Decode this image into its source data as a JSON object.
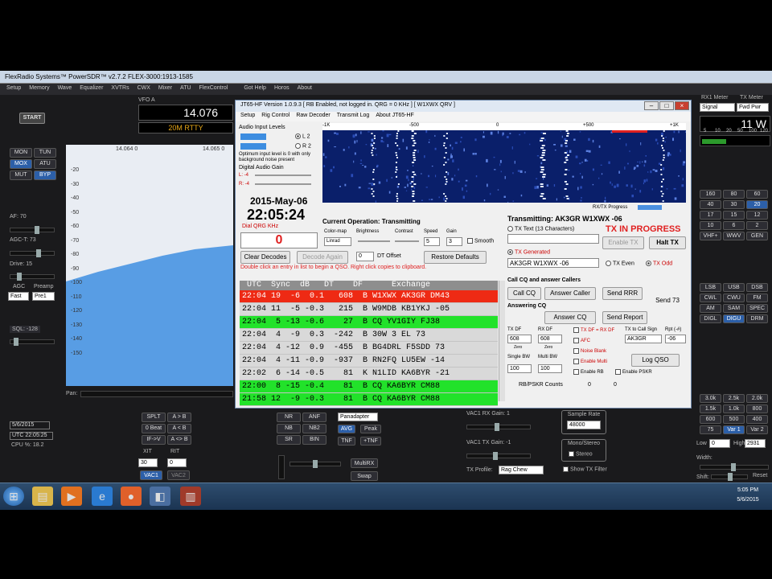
{
  "psdr": {
    "title": "FlexRadio Systems™  PowerSDR™  v2.7.2   FLEX-3000:1913-1585",
    "menu": [
      "Setup",
      "Memory",
      "Wave",
      "Equalizer",
      "XVTRs",
      "CWX",
      "Mixer",
      "ATU",
      "FlexControl",
      "",
      "Got Help",
      "Horos",
      "About"
    ],
    "start": "START",
    "vfo_label": "VFO A",
    "vfo_freq": "14.076",
    "vfo_mode": "20M RTTY",
    "pan_top": [
      "14.064 0",
      "14.065 0"
    ],
    "db_scale": [
      "-20",
      "-30",
      "-40",
      "-50",
      "-60",
      "-70",
      "-80",
      "-90",
      "-100",
      "-110",
      "-120",
      "-130",
      "-140",
      "-150"
    ],
    "mode_buttons": [
      "MON",
      "TUN",
      "MOX",
      "ATU",
      "MUT",
      "BYP"
    ],
    "af": "AF:  70",
    "agc_t": "AGC-T:  73",
    "drive": "Drive:  15",
    "agc": "AGC",
    "agc_val": "Fast",
    "preamp": "Preamp",
    "preamp_val": "Pre1",
    "sql": "SQL: -128",
    "pan_label": "Pan:",
    "date": "5/6/2015",
    "utc": "UTC 22:05:25",
    "cpu": "CPU %: 18.2",
    "split_buttons": [
      "SPLT",
      "A > B",
      "0 Beat",
      "A < B",
      "IF->V",
      "A <> B"
    ],
    "xit": "XIT",
    "rit": "RIT",
    "xit_val": "30",
    "rit_val": "0",
    "vac1": "VAC1",
    "vac2": "VAC2",
    "nr_buttons": [
      "NR",
      "ANF",
      "NB",
      "NB2",
      "SR",
      "BIN"
    ],
    "display_mode": "Panadapter",
    "avg": "AVG",
    "peak": "Peak",
    "tnf": "TNF",
    "ptnf": "+TNF",
    "multirx": "MultiRX",
    "swap": "Swap",
    "vac1_rx": "VAC1 RX Gain:  1",
    "vac1_tx": "VAC1 TX Gain:  -1",
    "tx_profile_label": "TX Profile:",
    "tx_profile_val": "Rag Chew",
    "sample_rate": "Sample Rate",
    "sample_rate_val": "48000",
    "mono_stereo": "Mono/Stereo",
    "stereo": "Stereo",
    "show_tx_filter": "Show TX Filter",
    "rx1_meter": "RX1 Meter",
    "tx_meter": "TX Meter",
    "meter_sel_rx": "Signal",
    "meter_sel_tx": "Fwd Pwr",
    "meter_val": "11 W",
    "meter_scale": [
      "5",
      "10",
      "20",
      "50",
      "100",
      "120"
    ],
    "bands": [
      "160",
      "80",
      "60",
      "40",
      "30",
      "20",
      "17",
      "15",
      "12",
      "10",
      "6",
      "2",
      "VHF+",
      "WWV",
      "GEN"
    ],
    "modes": [
      "LSB",
      "USB",
      "DSB",
      "CWL",
      "CWU",
      "FM",
      "AM",
      "SAM",
      "SPEC",
      "DIGL",
      "DIGU",
      "DRM"
    ],
    "filters": [
      "3.0k",
      "2.5k",
      "2.0k",
      "1.5k",
      "1.0k",
      "800",
      "600",
      "500",
      "400",
      "75",
      "Var 1",
      "Var 2"
    ],
    "low_label": "Low",
    "low_val": "0",
    "high_label": "High",
    "high_val": "2931",
    "width": "Width:",
    "shift": "Shift:",
    "reset": "Reset"
  },
  "jt": {
    "title": "JT65-HF Version 1.0.9.3  [ RB Enabled, not logged in.  QRG = 0 KHz ]  [ W1XWX QRV ]",
    "menu": [
      "Setup",
      "Rig Control",
      "Raw Decoder",
      "Transmit Log",
      "About JT65-HF"
    ],
    "audio_levels": "Audio Input Levels",
    "l2": "L 2",
    "r2": "R 2",
    "opt_note": "Optimum input level is 0 with only background noise present",
    "digital_gain": "Digital Audio Gain",
    "l_gain": "L: -4",
    "r_gain": "R: -4",
    "date": "2015-May-06",
    "time": "22:05:24",
    "dial_label": "Dial QRG KHz",
    "dial_val": "0",
    "scale": [
      "-1K",
      "-500",
      "0",
      "+500",
      "+1K"
    ],
    "rxtx_progress": "RX/TX Progress",
    "current_op_label": "Current Operation:",
    "current_op": "Transmitting",
    "color_map": "Color-map",
    "brightness": "Brightness",
    "contrast": "Contrast",
    "speed": "Speed",
    "gain": "Gain",
    "color_map_val": "Linrad",
    "speed_val": "5",
    "gain_val": "3",
    "smooth": "Smooth",
    "clear_decodes": "Clear Decodes",
    "decode_again": "Decode Again",
    "dt_offset_val": "0",
    "dt_offset": "DT Offset",
    "restore_defaults": "Restore Defaults",
    "hint": "Double click an entry in list to begin a QSO.  Right click copies to clipboard.",
    "table_header": " UTC  Sync  dB   DT    DF      Exchange",
    "rows": [
      {
        "text": "22:04 19  -6  0.1   608  B W1XWX AK3GR DM43",
        "style": "red"
      },
      {
        "text": "22:04 11  -5 -0.3   215  B W9MDB KB1YKJ -05",
        "style": ""
      },
      {
        "text": "22:04  5 -13 -0.6    27  B CQ YV1GIY FJ38",
        "style": "green"
      },
      {
        "text": "22:04  4  -9  0.3  -242  B 30W 3 EL 73",
        "style": ""
      },
      {
        "text": "22:04  4 -12  0.9  -455  B BG4DRL F5SDD 73",
        "style": ""
      },
      {
        "text": "22:04  4 -11 -0.9  -937  B RN2FQ LU5EW -14",
        "style": ""
      },
      {
        "text": "22:02  6 -14 -0.5    81  K N1LID KA6BYR -21",
        "style": ""
      },
      {
        "text": "22:00  8 -15 -0.4    81  B CQ KA6BYR CM88",
        "style": "green"
      },
      {
        "text": "21:58 12  -9 -0.3    81  B CQ KA6BYR CM88",
        "style": "green"
      }
    ],
    "transmitting_label": "Transmitting: AK3GR W1XWX -06",
    "tx_in_progress": "TX IN PROGRESS",
    "tx_text": "TX Text (13 Characters)",
    "enable_tx": "Enable TX",
    "halt_tx": "Halt TX",
    "tx_generated": "TX Generated",
    "tx_generated_msg": "AK3GR W1XWX -06",
    "tx_even": "TX Even",
    "tx_odd": "TX Odd",
    "call_cq_label": "Call CQ and answer Callers",
    "call_cq": "Call CQ",
    "answer_caller": "Answer Caller",
    "send_rrr": "Send RRR",
    "send_73": "Send 73",
    "answering_cq": "Answering CQ",
    "answer_cq": "Answer CQ",
    "send_report": "Send Report",
    "tx_df": "TX DF",
    "rx_df": "RX DF",
    "tx_df_val": "608",
    "rx_df_val": "608",
    "zero": "Zero",
    "tx_eq_rx": "TX DF = RX DF",
    "afc": "AFC",
    "noise_blank": "Noise Blank",
    "enable_multi": "Enable Multi",
    "tx_to_call": "TX to Call Sign",
    "rpt": "Rpt (-#)",
    "call_val": "AK3GR",
    "rpt_val": "-06",
    "log_qso": "Log QSO",
    "single_bw": "Single BW",
    "multi_bw": "Multi BW",
    "single_bw_val": "100",
    "multi_bw_val": "100",
    "enable_rb": "Enable RB",
    "enable_pskr": "Enable PSKR",
    "rb_counts": "RB/PSKR Counts",
    "rb_count_val": "0",
    "pskr_count_val": "0"
  },
  "taskbar": {
    "time": "5:05 PM",
    "date": "5/6/2015"
  }
}
